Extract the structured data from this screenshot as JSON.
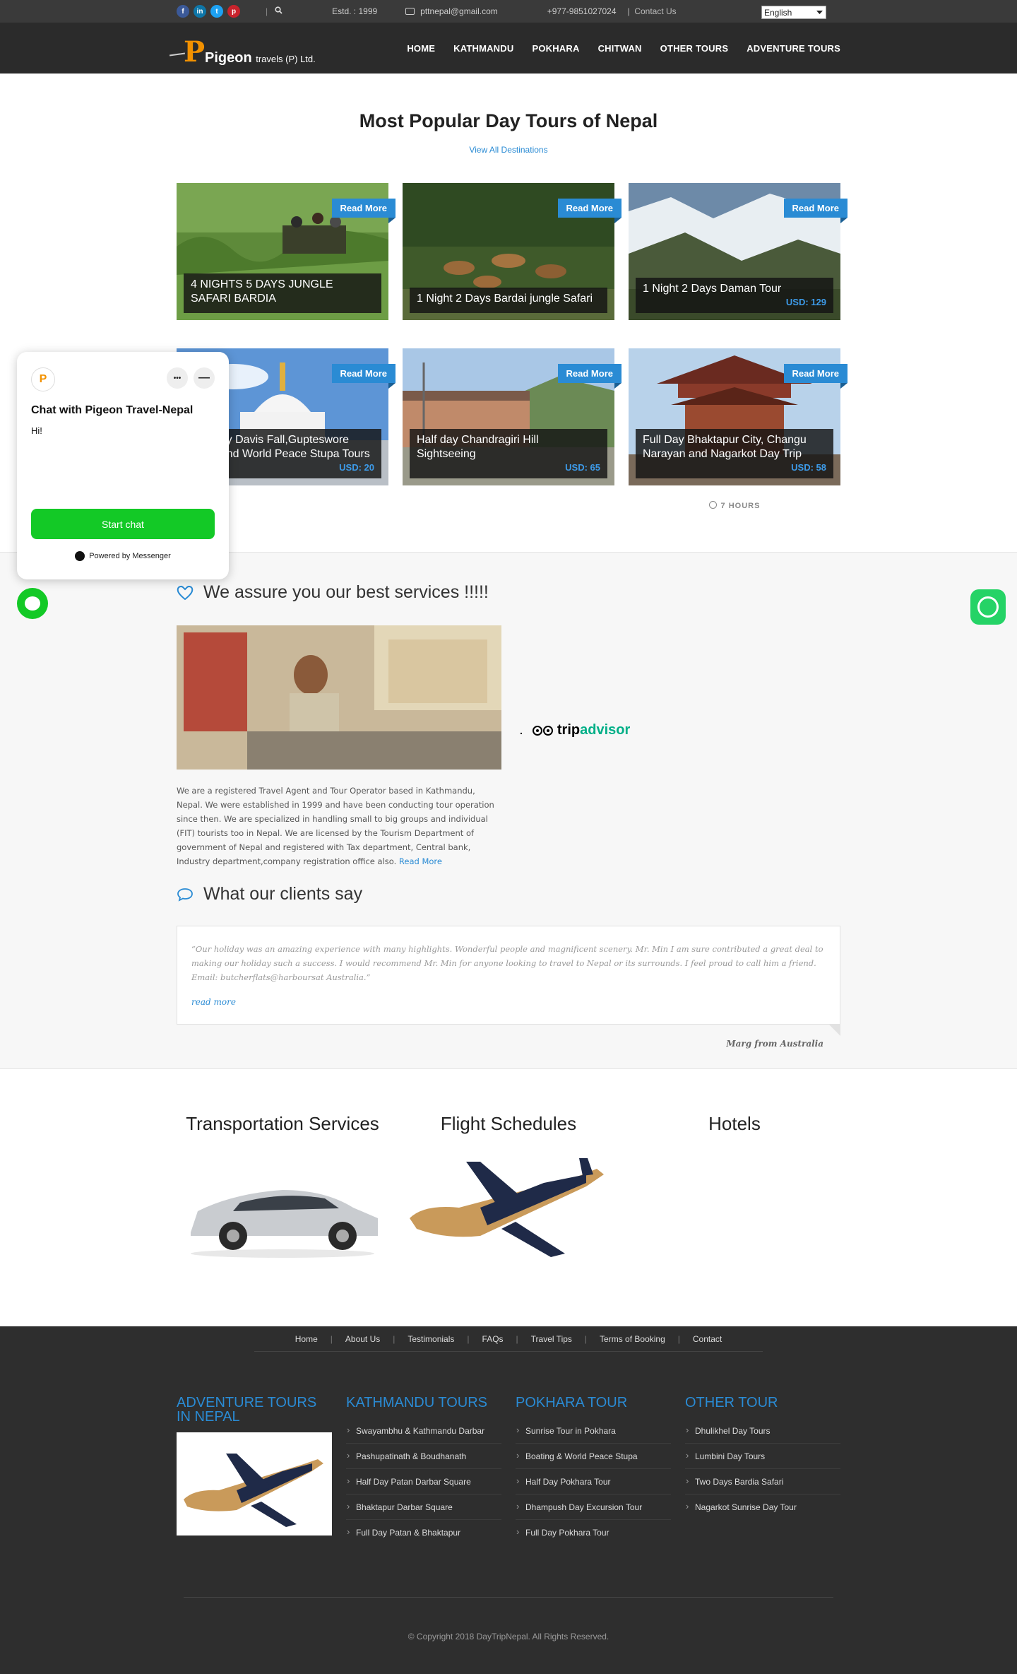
{
  "topbar": {
    "social": [
      "f",
      "in",
      "t",
      "p"
    ],
    "sep": "|",
    "estd": "Estd. : 1999",
    "email": "pttnepal@gmail.com",
    "phone": "+977-9851027024",
    "contact_sep": "|",
    "contact": "Contact Us",
    "language": "English"
  },
  "header": {
    "logo_main": "Pigeon",
    "logo_sub": "travels (P) Ltd.",
    "nav": [
      "HOME",
      "KATHMANDU",
      "POKHARA",
      "CHITWAN",
      "OTHER TOURS",
      "ADVENTURE TOURS"
    ]
  },
  "popular": {
    "title": "Most Popular Day Tours of Nepal",
    "view_all": "View All Destinations",
    "read_more": "Read More",
    "tours": [
      {
        "title": "4 NIGHTS 5 DAYS JUNGLE SAFARI BARDIA",
        "price": ""
      },
      {
        "title": "1 Night 2 Days Bardai jungle Safari",
        "price": ""
      },
      {
        "title": "1 Night 2 Days Daman Tour",
        "price": "USD: 129"
      },
      {
        "title": "Full Day Davis Fall,Gupteswore Cave and World Peace Stupa Tours",
        "price": "USD: 20"
      },
      {
        "title": "Half day Chandragiri Hill Sightseeing",
        "price": "USD: 65"
      },
      {
        "title": "Full Day Bhaktapur City, Changu Narayan and Nagarkot Day Trip",
        "price": "USD: 58"
      }
    ],
    "duration": "7 HOURS"
  },
  "assure": {
    "heading": "We assure you our best services !!!!!",
    "about": "We are a registered Travel Agent and Tour Operator based in Kathmandu, Nepal. We were established in 1999 and have been conducting tour operation since then. We are specialized in handling small to big groups and individual (FIT) tourists too in Nepal. We are licensed by the Tourism Department of government of Nepal and registered with Tax department, Central bank, Industry department,company registration office also.",
    "read_more": "Read More",
    "tripadvisor_dot": ".",
    "tripadvisor_trip": "trip",
    "tripadvisor_advisor": "advisor"
  },
  "clients": {
    "heading": "What our clients say",
    "quote": "“Our holiday was an amazing experience with many highlights. Wonderful people and magnificent scenery. Mr. Min I am sure contributed a great deal to making our holiday such a success. I would recommend Mr. Min for anyone looking to travel to Nepal or its surrounds. I feel proud to call him a friend. Email: butcherflats@harboursat Australia.”",
    "read_more": "read more",
    "author": "Marg from Australia"
  },
  "services": [
    "Transportation Services",
    "Flight Schedules",
    "Hotels"
  ],
  "footer": {
    "links": [
      "Home",
      "About Us",
      "Testimonials",
      "FAQs",
      "Travel Tips",
      "Terms of Booking",
      "Contact"
    ],
    "cols": [
      {
        "title": "ADVENTURE TOURS IN NEPAL",
        "items": []
      },
      {
        "title": "KATHMANDU TOURS",
        "items": [
          "Swayambhu & Kathmandu Darbar",
          "Pashupatinath & Boudhanath",
          "Half Day Patan Darbar Square",
          "Bhaktapur Darbar Square",
          "Full Day Patan & Bhaktapur"
        ]
      },
      {
        "title": "POKHARA TOUR",
        "items": [
          "Sunrise Tour in Pokhara",
          "Boating & World Peace Stupa",
          "Half Day Pokhara Tour",
          "Dhampush Day Excursion Tour",
          "Full Day Pokhara Tour"
        ]
      },
      {
        "title": "OTHER TOUR",
        "items": [
          "Dhulikhel Day Tours",
          "Lumbini Day Tours",
          "Two Days Bardia Safari",
          "Nagarkot Sunrise Day Tour"
        ]
      }
    ],
    "copyright": "© Copyright 2018 DayTripNepal. All Rights Reserved."
  },
  "chat": {
    "title": "Chat with Pigeon Travel-Nepal",
    "greeting": "Hi!",
    "start": "Start chat",
    "powered": "Powered by Messenger",
    "more": "•••",
    "minimize": "—"
  },
  "colors": {
    "accent": "#2a8bd4",
    "dark": "#2b2b2b",
    "chat_green": "#13c926",
    "whatsapp": "#25d366"
  }
}
